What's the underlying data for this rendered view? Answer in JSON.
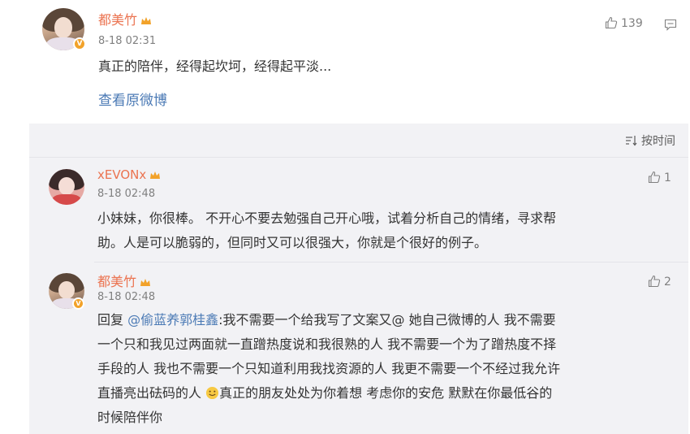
{
  "post": {
    "username": "都美竹",
    "time": "8-18 02:31",
    "content": "真正的陪伴，经得起坎坷，经得起平淡...",
    "view_original": "查看原微博",
    "likes": "139"
  },
  "sort": {
    "label": "按时间"
  },
  "comments": [
    {
      "username": "xEVONx",
      "time": "8-18 02:48",
      "likes": "1",
      "lines": [
        "小妹妹，你很棒。 不开心不要去勉强自己开心哦，试着分析自己的情绪，寻求帮",
        "助。人是可以脆弱的，但同时又可以很强大，你就是个很好的例子。"
      ]
    },
    {
      "username": "都美竹",
      "time": "8-18 02:48",
      "likes": "2",
      "reply_prefix": "回复 ",
      "mention": "@偷蓝养郭桂鑫",
      "first_line_rest": ":我不需要一个给我写了文案又@ 她自己微博的人 我不需要",
      "lines": [
        "一个只和我见过两面就一直蹭热度说和我很熟的人 我不需要一个为了蹭热度不择",
        "手段的人 我也不需要一个只知道利用我找资源的人 我更不需要一个不经过我允许"
      ],
      "line4_before": "直播亮出砝码的人 ",
      "line4_after": "真正的朋友处处为你着想 考虑你的安危 默默在你最低谷的",
      "line5": "时候陪伴你"
    }
  ],
  "colors": {
    "username": "#eb7350",
    "link": "#4b7ab5",
    "badge": "#f2a22a"
  },
  "icons": [
    "thumbs-up-icon",
    "comment-icon",
    "sort-icon",
    "crown-icon",
    "verified-v-icon",
    "smile-emoji-icon"
  ]
}
